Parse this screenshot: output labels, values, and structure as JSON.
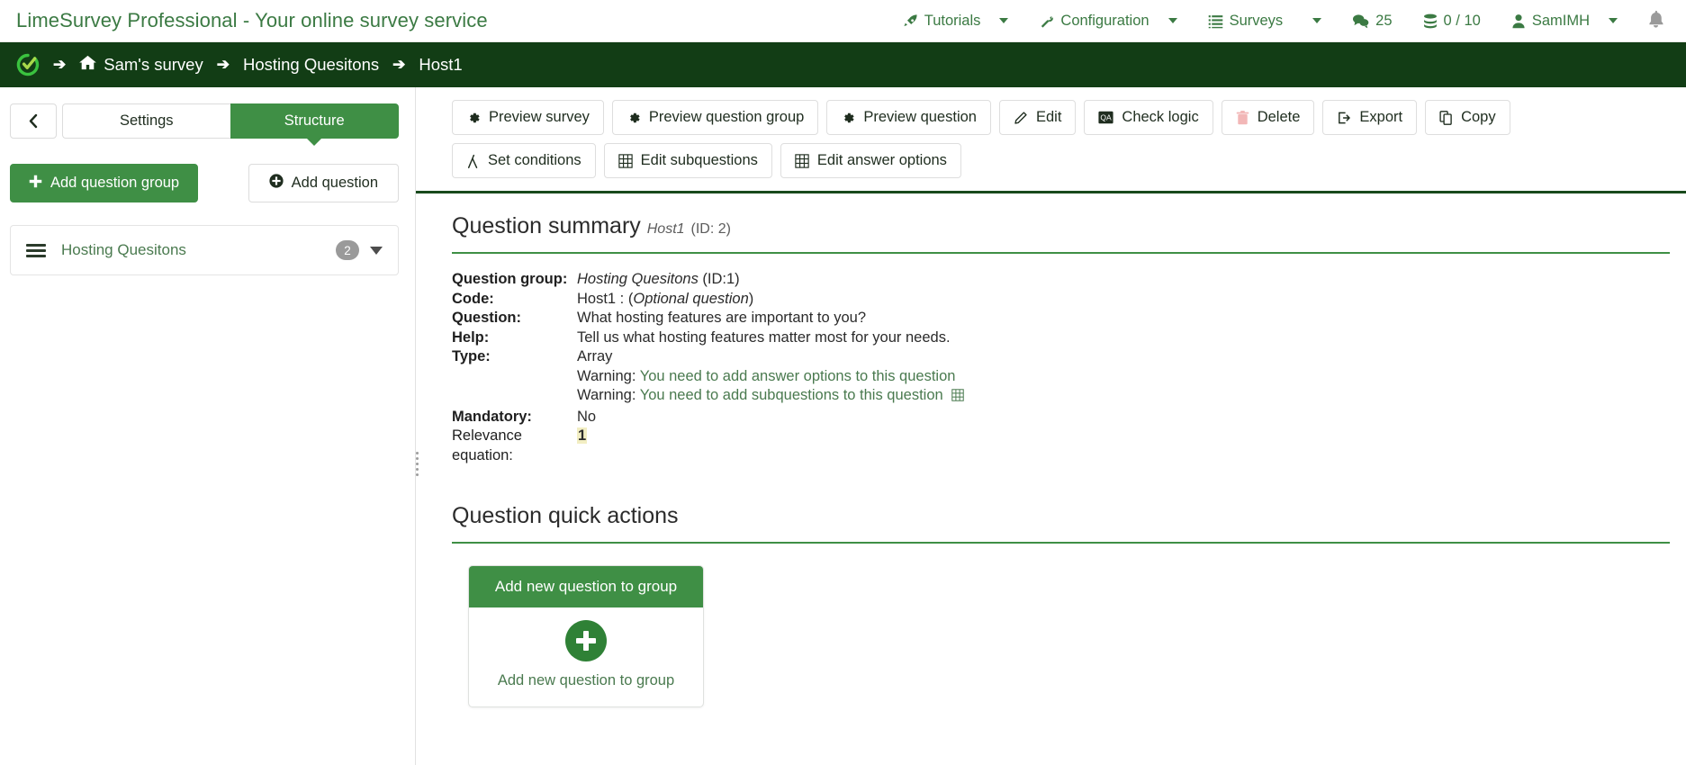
{
  "topbar": {
    "brand": "LimeSurvey Professional - Your online survey service",
    "nav": [
      {
        "label": "Tutorials",
        "icon": "rocket-icon",
        "caret": true
      },
      {
        "label": "Configuration",
        "icon": "wrench-icon",
        "caret": true
      },
      {
        "label": "Surveys",
        "icon": "list-icon",
        "caret": true
      },
      {
        "label": "25",
        "icon": "comments-icon",
        "caret": false
      },
      {
        "label": "0 / 10",
        "icon": "database-icon",
        "caret": false
      },
      {
        "label": "SamIMH",
        "icon": "user-icon",
        "caret": true
      }
    ],
    "notification_icon": "bell-icon"
  },
  "breadcrumb": {
    "logo": "limesurvey-logo-icon",
    "items": [
      {
        "label": "Sam's survey",
        "icon": "home-icon"
      },
      {
        "label": "Hosting Quesitons",
        "icon": ""
      },
      {
        "label": "Host1",
        "icon": ""
      }
    ],
    "separator": "➔"
  },
  "sidebar": {
    "collapse_icon": "chevron-left-icon",
    "tabs": [
      {
        "label": "Settings",
        "active": false
      },
      {
        "label": "Structure",
        "active": true
      }
    ],
    "add_group_label": "Add question group",
    "add_group_icon": "plus-icon",
    "add_question_label": "Add question",
    "add_question_icon": "plus-circle-icon",
    "groups": [
      {
        "name": "Hosting Quesitons",
        "count": "2",
        "handle_icon": "drag-handle-icon",
        "caret_icon": "caret-down-icon"
      }
    ]
  },
  "toolbar": {
    "row1": [
      {
        "label": "Preview survey",
        "icon": "gear-icon"
      },
      {
        "label": "Preview question group",
        "icon": "gear-icon"
      },
      {
        "label": "Preview question",
        "icon": "gear-icon"
      },
      {
        "label": "Edit",
        "icon": "pencil-icon"
      },
      {
        "label": "Check logic",
        "icon": "logic-icon"
      },
      {
        "label": "Delete",
        "icon": "trash-icon"
      },
      {
        "label": "Export",
        "icon": "export-icon"
      },
      {
        "label": "Copy",
        "icon": "copy-icon"
      }
    ],
    "row2": [
      {
        "label": "Set conditions",
        "icon": "conditions-icon"
      },
      {
        "label": "Edit subquestions",
        "icon": "grid-icon"
      },
      {
        "label": "Edit answer options",
        "icon": "grid-icon"
      }
    ]
  },
  "summary": {
    "title": "Question summary",
    "title_code": "Host1",
    "title_id": "(ID: 2)",
    "rows": [
      {
        "label": "Question group:",
        "value_em": "Hosting Quesitons",
        "value_plain": " (ID:1)"
      },
      {
        "label": "Code:",
        "value_pre": "Host1 : (",
        "value_em": "Optional question",
        "value_post": ")"
      },
      {
        "label": "Question:",
        "value_plain": "What hosting features are important to you?"
      },
      {
        "label": "Help:",
        "value_plain": "Tell us what hosting features matter most for your needs."
      },
      {
        "label": "Type:",
        "value_plain": "Array"
      }
    ],
    "warnings": [
      {
        "prefix": "Warning: ",
        "text": "You need to add answer options to this question",
        "icon": ""
      },
      {
        "prefix": "Warning: ",
        "text": "You need to add subquestions to this question",
        "icon": "grid-icon"
      }
    ],
    "mandatory_label": "Mandatory:",
    "mandatory_value": "No",
    "relevance_label": "Relevance equation:",
    "relevance_value": "1"
  },
  "quick_actions": {
    "title": "Question quick actions",
    "card": {
      "header": "Add new question to group",
      "icon": "plus-circle-icon",
      "caption": "Add new question to group"
    }
  },
  "colors": {
    "brand_green": "#3f8f45",
    "dark_green": "#123d15",
    "link_green": "#4a7a4f",
    "badge_gray": "#9a9a9a",
    "highlight_yellow": "#f2eec3"
  }
}
